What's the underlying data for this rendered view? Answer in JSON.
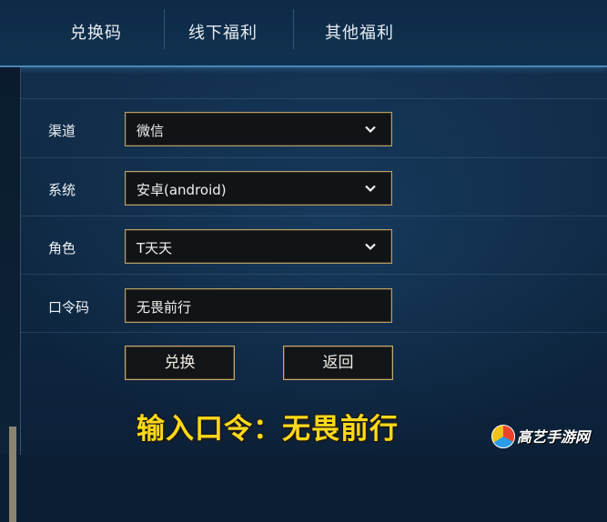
{
  "tabs": [
    {
      "label": "兑换码"
    },
    {
      "label": "线下福利"
    },
    {
      "label": "其他福利"
    }
  ],
  "form": {
    "channel": {
      "label": "渠道",
      "value": "微信"
    },
    "system": {
      "label": "系统",
      "value": "安卓(android)"
    },
    "role": {
      "label": "角色",
      "value": "T天天"
    },
    "password": {
      "label": "口令码",
      "value": "无畏前行"
    }
  },
  "buttons": {
    "redeem": "兑换",
    "back": "返回"
  },
  "caption": "输入口令：无畏前行",
  "watermark": "高艺手游网",
  "colors": {
    "accent_gold": "#b7a06a",
    "caption_yellow": "#ffd91a",
    "tab_border": "#4a86b8"
  }
}
